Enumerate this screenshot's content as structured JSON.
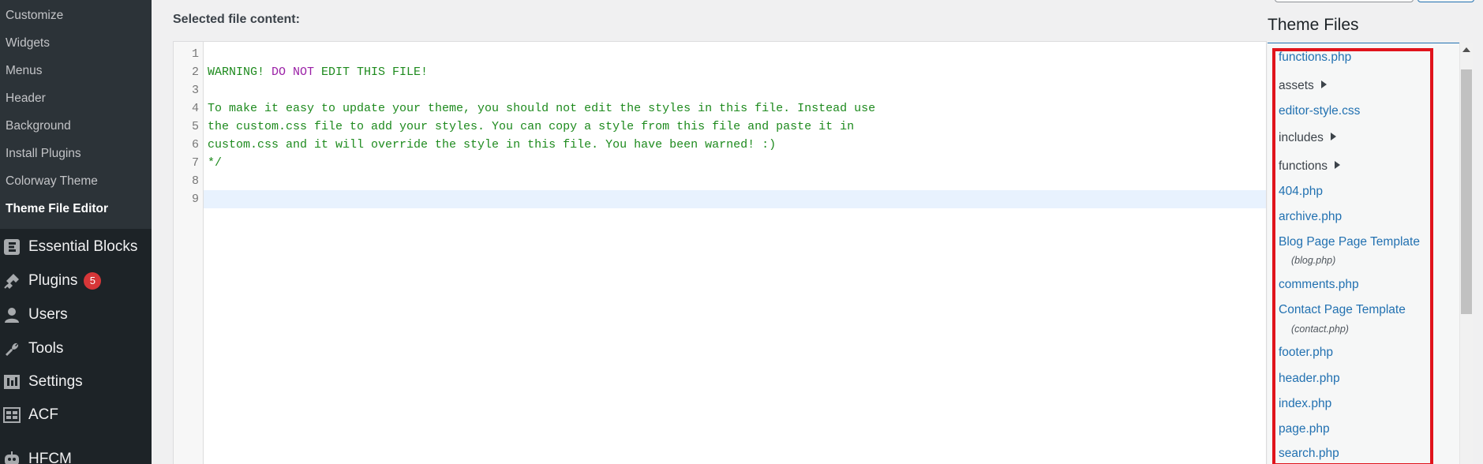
{
  "sidebar": {
    "submenu": [
      "Customize",
      "Widgets",
      "Menus",
      "Header",
      "Background",
      "Install Plugins",
      "Colorway Theme",
      "Theme File Editor"
    ],
    "main": [
      {
        "label": "Essential Blocks",
        "icon": "essential-blocks-icon"
      },
      {
        "label": "Plugins",
        "icon": "plugin-icon",
        "badge": "5"
      },
      {
        "label": "Users",
        "icon": "user-icon"
      },
      {
        "label": "Tools",
        "icon": "wrench-icon"
      },
      {
        "label": "Settings",
        "icon": "settings-icon"
      },
      {
        "label": "ACF",
        "icon": "acf-grid-icon"
      },
      {
        "label": "HFCM",
        "icon": "robot-icon"
      }
    ]
  },
  "editor": {
    "label": "Selected file content:",
    "lines": [
      {
        "n": "1",
        "a": "",
        "b": "",
        "c": ""
      },
      {
        "n": "2",
        "a": "WARNING! ",
        "b": "DO NOT",
        "c": " EDIT THIS FILE!"
      },
      {
        "n": "3",
        "a": "",
        "b": "",
        "c": ""
      },
      {
        "n": "4",
        "a": "To make it easy to update your theme, you should not edit the styles in this file. Instead use",
        "b": "",
        "c": ""
      },
      {
        "n": "5",
        "a": "the custom.css file to add your styles. You can copy a style from this file and paste it in",
        "b": "",
        "c": ""
      },
      {
        "n": "6",
        "a": "custom.css and it will override the style in this file. You have been warned! :)",
        "b": "",
        "c": ""
      },
      {
        "n": "7",
        "a": "*/",
        "b": "",
        "c": ""
      },
      {
        "n": "8",
        "a": "",
        "b": "",
        "c": ""
      },
      {
        "n": "9",
        "a": "",
        "b": "",
        "c": ""
      }
    ]
  },
  "theme_files": {
    "title": "Theme Files",
    "items": [
      {
        "label": "functions.php",
        "type": "file"
      },
      {
        "label": "assets",
        "type": "folder"
      },
      {
        "label": "editor-style.css",
        "type": "file"
      },
      {
        "label": "includes",
        "type": "folder"
      },
      {
        "label": "functions",
        "type": "folder"
      },
      {
        "label": "404.php",
        "type": "file"
      },
      {
        "label": "archive.php",
        "type": "file"
      },
      {
        "label": "Blog Page Page Template",
        "type": "file",
        "sub": "(blog.php)"
      },
      {
        "label": "comments.php",
        "type": "file"
      },
      {
        "label": "Contact Page Template",
        "type": "file",
        "sub": "(contact.php)"
      },
      {
        "label": "footer.php",
        "type": "file"
      },
      {
        "label": "header.php",
        "type": "file"
      },
      {
        "label": "index.php",
        "type": "file"
      },
      {
        "label": "page.php",
        "type": "file"
      },
      {
        "label": "search.php",
        "type": "file"
      }
    ]
  },
  "colors": {
    "sidebar": "#1d2327",
    "link": "#2271b1",
    "highlight": "#e0141c",
    "code_green": "#1d8a1d",
    "keyword": "#9a1fa6"
  }
}
